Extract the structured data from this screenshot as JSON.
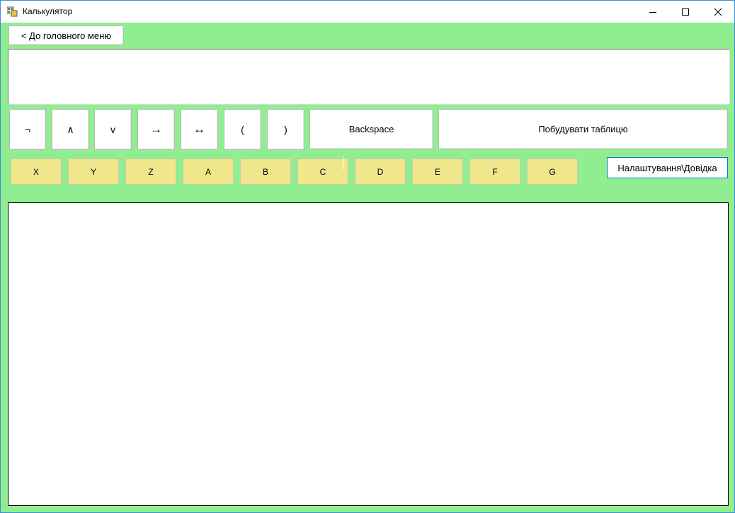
{
  "window": {
    "title": "Калькулятор",
    "icons": [
      "app-icon",
      "minimize-icon",
      "maximize-icon",
      "close-icon"
    ]
  },
  "colors": {
    "background": "#90ee90",
    "variable_button": "#f0e68c",
    "focus_border": "#0078d7"
  },
  "toolbar": {
    "back_label": "< До головного меню"
  },
  "expression": {
    "value": ""
  },
  "operators": [
    {
      "label": "¬"
    },
    {
      "label": "∧"
    },
    {
      "label": "v"
    },
    {
      "label": "→"
    },
    {
      "label": "↔"
    },
    {
      "label": "("
    },
    {
      "label": ")"
    }
  ],
  "actions": {
    "backspace_label": "Backspace",
    "build_table_label": "Побудувати таблицю",
    "settings_label": "Налаштування\\Довідка"
  },
  "variables": [
    "X",
    "Y",
    "Z",
    "A",
    "B",
    "C",
    "D",
    "E",
    "F",
    "G"
  ]
}
